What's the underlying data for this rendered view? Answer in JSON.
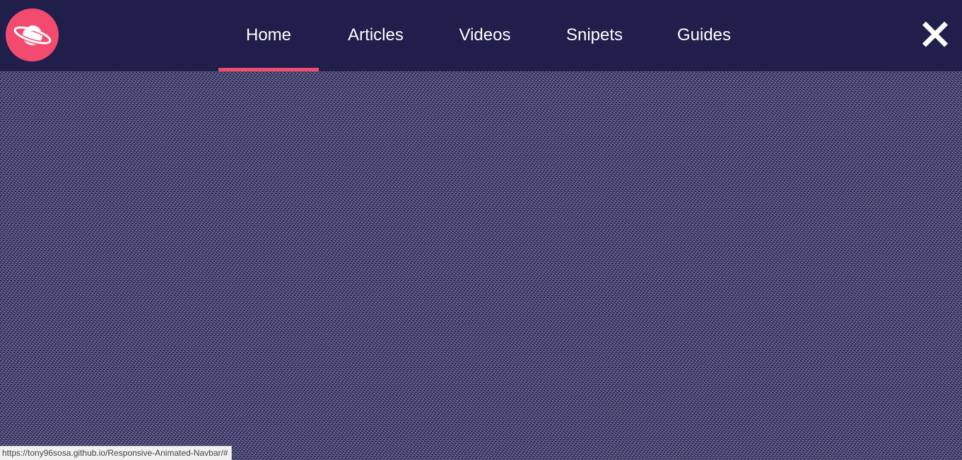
{
  "navbar": {
    "logo_icon": "planet-icon",
    "items": [
      {
        "label": "Home",
        "active": true
      },
      {
        "label": "Articles",
        "active": false
      },
      {
        "label": "Videos",
        "active": false
      },
      {
        "label": "Snipets",
        "active": false
      },
      {
        "label": "Guides",
        "active": false
      }
    ],
    "close_icon": "close-icon",
    "colors": {
      "background": "#201e4b",
      "accent": "#f34a6f",
      "text": "#ffffff"
    }
  },
  "status_bar": {
    "url": "https://tony96sosa.github.io/Responsive-Animated-Navbar/#"
  }
}
